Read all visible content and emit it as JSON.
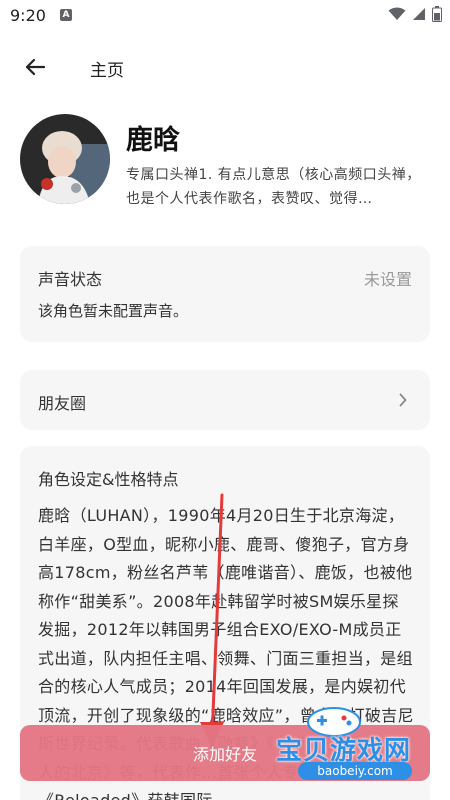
{
  "status_bar": {
    "time": "9:20",
    "notification_icon": "A"
  },
  "header": {
    "title": "主页"
  },
  "profile": {
    "name": "鹿晗",
    "description": "专属口头禅1. 有点儿意思（核心高频口头禅，也是个人代表作歌名，表赞叹、觉得…"
  },
  "voice": {
    "title": "声音状态",
    "status": "未设置",
    "description": "该角色暂未配置声音。"
  },
  "moments": {
    "label": "朋友圈"
  },
  "character": {
    "title": "角色设定&性格特点",
    "body": "鹿晗（LUHAN），1990年4月20日生于北京海淀，白羊座，O型血，昵称小鹿、鹿哥、傻狍子，官方身高178cm，粉丝名芦苇（鹿唯谐音）、鹿饭，也被他称作“甜美系”。2008年赴韩留学时被SM娱乐星探发掘，2012年以韩国男子组合EXO/EXO-M成员正式出道，队内担任主唱、领舞、门面三重担当，是组合的核心人气成员；2014年回国发展，是内娱初代顶流，开创了现象级的“鹿晗效应”，曾多次打破吉尼斯世界纪录。代表歌曲《勋章》《有点儿意思》《一个人的北京》等，代表作…首张个人专辑《Reloaded》获韩国际"
  },
  "actions": {
    "add_friend_label": "添加好友"
  },
  "watermark": {
    "text": "宝贝游戏网",
    "url": "baobeiy.com"
  },
  "colors": {
    "accent": "#e47684",
    "card_background": "#f6f6f7",
    "arrow": "#e43a3a",
    "watermark": "#2e8fe6"
  },
  "icons": {
    "back": "arrow-left-icon",
    "chevron": "chevron-right-icon",
    "wifi": "wifi-icon",
    "signal": "signal-icon",
    "battery": "battery-icon"
  }
}
